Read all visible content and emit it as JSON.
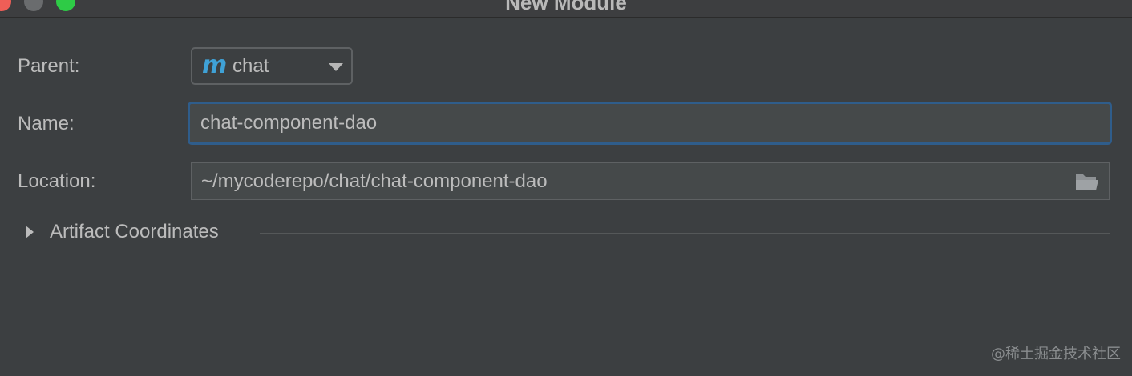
{
  "window": {
    "title": "New Module"
  },
  "form": {
    "parent": {
      "label": "Parent:",
      "value": "chat",
      "icon": "maven-module-icon"
    },
    "name": {
      "label": "Name:",
      "value": "chat-component-dao"
    },
    "location": {
      "label": "Location:",
      "value": "~/mycoderepo/chat/chat-component-dao",
      "icon": "folder-icon"
    },
    "artifact": {
      "label": "Artifact Coordinates"
    }
  },
  "watermark": "@稀土掘金技术社区",
  "colors": {
    "accent": "#3fa1d6",
    "focus_border": "#2f5d8b",
    "background": "#3c3f41"
  }
}
